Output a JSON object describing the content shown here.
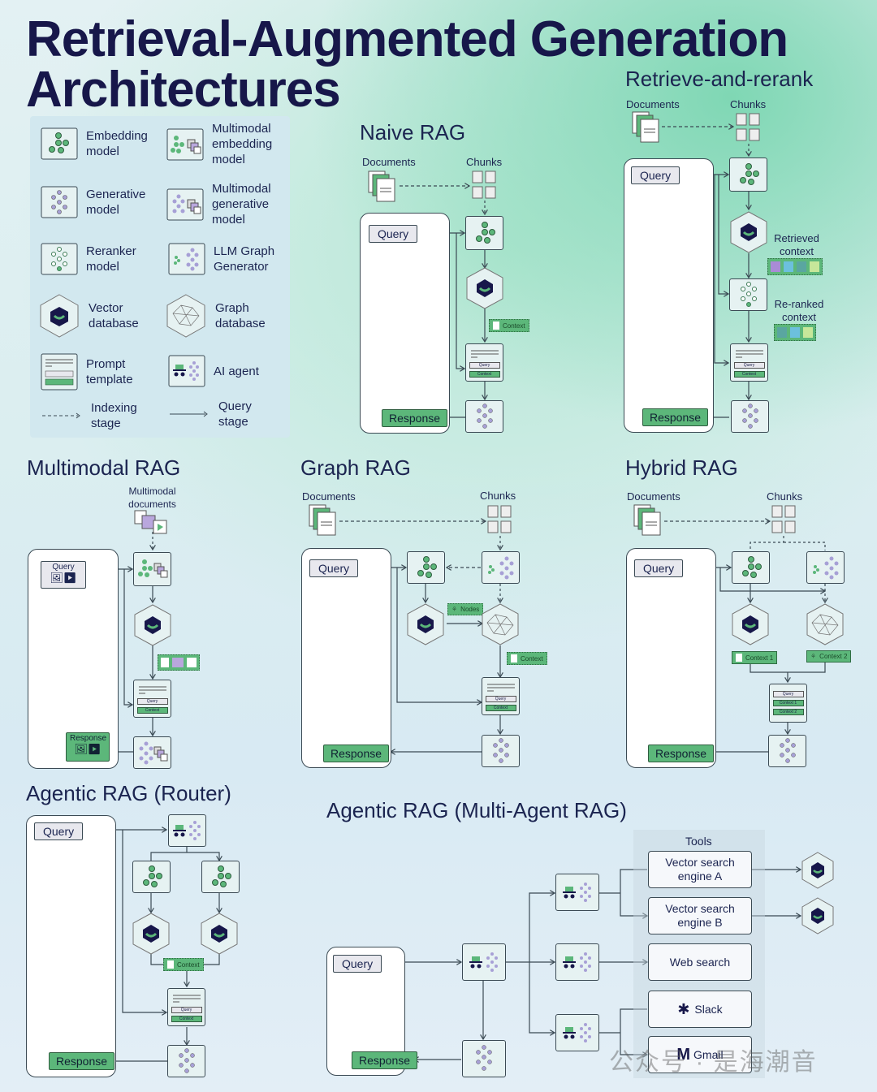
{
  "title": {
    "line1": "Retrieval-Augmented Generation",
    "line2": "Architectures"
  },
  "legend": {
    "items": [
      {
        "icon": "embedding-model-icon",
        "label": "Embedding model"
      },
      {
        "icon": "multimodal-embedding-model-icon",
        "label": "Multimodal embedding model"
      },
      {
        "icon": "generative-model-icon",
        "label": "Generative model"
      },
      {
        "icon": "multimodal-generative-model-icon",
        "label": "Multimodal generative model"
      },
      {
        "icon": "reranker-model-icon",
        "label": "Reranker model"
      },
      {
        "icon": "llm-graph-generator-icon",
        "label": "LLM Graph Generator"
      },
      {
        "icon": "vector-database-icon",
        "label": "Vector database"
      },
      {
        "icon": "graph-database-icon",
        "label": "Graph database"
      },
      {
        "icon": "prompt-template-icon",
        "label": "Prompt template"
      },
      {
        "icon": "ai-agent-icon",
        "label": "AI agent"
      },
      {
        "icon": "dashed-arrow-icon",
        "label": "Indexing stage"
      },
      {
        "icon": "solid-arrow-icon",
        "label": "Query stage"
      }
    ]
  },
  "common": {
    "documents": "Documents",
    "chunks": "Chunks",
    "query": "Query",
    "response": "Response",
    "context": "Context",
    "context1": "Context 1",
    "context2": "Context 2",
    "nodes": "Nodes"
  },
  "sections": {
    "naive": {
      "title": "Naive RAG"
    },
    "rerank": {
      "title": "Retrieve-and-rerank",
      "retrieved": "Retrieved context",
      "reranked": "Re-ranked context"
    },
    "multimodal": {
      "title": "Multimodal RAG",
      "docs": "Multimodal documents"
    },
    "graph": {
      "title": "Graph RAG"
    },
    "hybrid": {
      "title": "Hybrid RAG"
    },
    "router": {
      "title": "Agentic RAG (Router)"
    },
    "multi_agent": {
      "title": "Agentic RAG (Multi-Agent RAG)",
      "tools_label": "Tools",
      "tools": [
        "Vector search engine A",
        "Vector search engine B",
        "Web search",
        "Slack",
        "Gmail"
      ]
    }
  },
  "watermark": "公众号 · 是海潮音",
  "colors": {
    "accent_green": "#5cb77a",
    "dark_navy": "#17174a",
    "outline": "#3b4a54"
  }
}
